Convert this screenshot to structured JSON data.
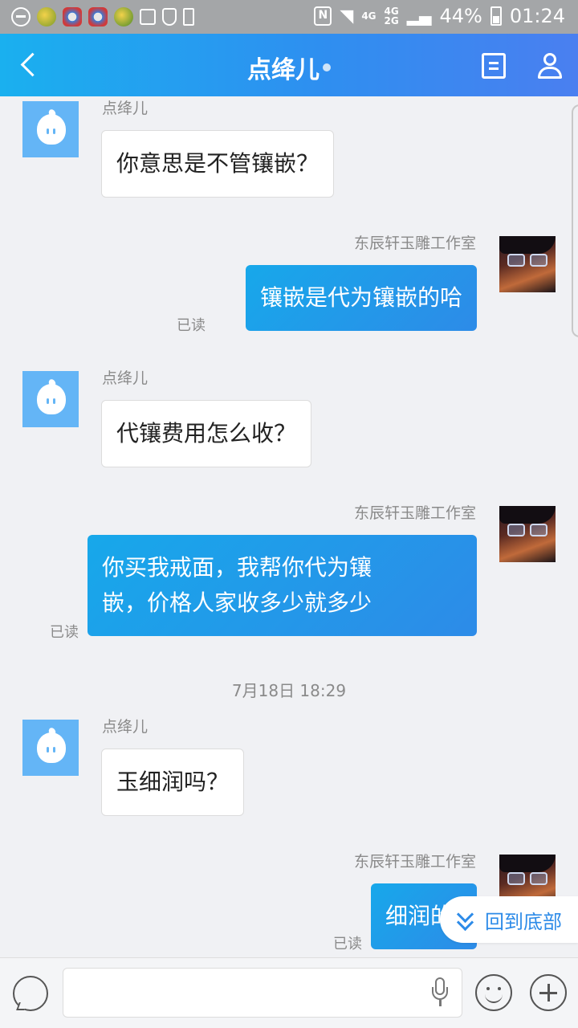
{
  "status_bar": {
    "network_top": "4G",
    "network_bottom": "2G",
    "network_main": "4G",
    "battery": "44%",
    "time": "01:24",
    "nfc": "N"
  },
  "header": {
    "back_icon": "chevron-left-icon",
    "title": "点绛儿",
    "doc_icon": "document-icon",
    "profile_icon": "user-icon"
  },
  "messages": [
    {
      "sender": "点绛儿",
      "direction": "in",
      "text": "你意思是不管镶嵌？"
    },
    {
      "sender": "东辰轩玉雕工作室",
      "direction": "out",
      "text": "镶嵌是代为镶嵌的哈",
      "status": "已读"
    },
    {
      "sender": "点绛儿",
      "direction": "in",
      "text": "代镶费用怎么收？"
    },
    {
      "sender": "东辰轩玉雕工作室",
      "direction": "out",
      "text_line1": "你买我戒面，我帮你代为镶",
      "text_line2": "嵌，价格人家收多少就多少",
      "status": "已读"
    },
    {
      "timestamp": "7月18日 18:29"
    },
    {
      "sender": "点绛儿",
      "direction": "in",
      "text": "玉细润吗？"
    },
    {
      "sender": "东辰轩玉雕工作室",
      "direction": "out",
      "text": "细润的",
      "status": "已读"
    }
  ],
  "back_to_bottom": {
    "label": "回到底部",
    "icon": "double-chevron-down-icon"
  },
  "input_bar": {
    "chat_icon": "chat-bubble-icon",
    "input_placeholder": "",
    "mic_icon": "microphone-icon",
    "emoji_icon": "emoji-icon",
    "plus_icon": "plus-icon"
  },
  "colors": {
    "header_start": "#1ab0ef",
    "header_end": "#4a7ff0",
    "outgoing_bubble": "#2d8be8",
    "incoming_bubble": "#ffffff",
    "background": "#f0f1f4",
    "qq_avatar": "#64b5f6"
  }
}
